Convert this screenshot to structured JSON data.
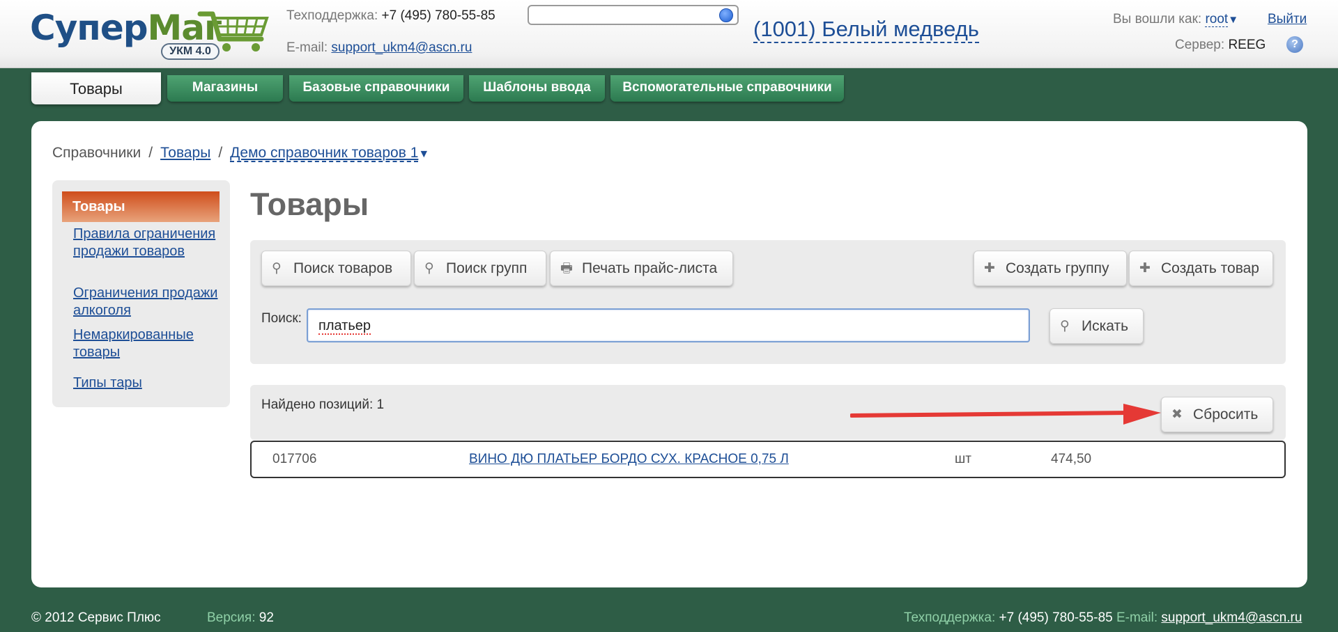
{
  "header": {
    "logo_part1": "Супер",
    "logo_part2": "Маг",
    "logo_badge": "УКМ 4.0",
    "support_phone_label": "Техподдержка:",
    "support_phone": "+7 (495) 780-55-85",
    "support_email_label": "E-mail:",
    "support_email": "support_ukm4@ascn.ru",
    "store": "(1001) Белый медведь",
    "logged_in_label": "Вы вошли как:",
    "user": "root",
    "logout": "Выйти",
    "server_label": "Сервер:",
    "server": "REEG",
    "help": "?"
  },
  "tabs": [
    {
      "label": "Товары",
      "active": true
    },
    {
      "label": "Магазины"
    },
    {
      "label": "Базовые справочники"
    },
    {
      "label": "Шаблоны ввода"
    },
    {
      "label": "Вспомогательные справочники"
    }
  ],
  "breadcrumbs": {
    "root": "Справочники",
    "sep": "/",
    "items": "Товары",
    "catalog": "Демо справочник товаров 1"
  },
  "sidenav": {
    "active": "Товары",
    "items": [
      "Правила ограничения продажи товаров",
      "Ограничения продажи алкоголя",
      "Немаркированные товары",
      "Типы тары"
    ]
  },
  "page_title": "Товары",
  "toolbar": {
    "search_goods": "Поиск товаров",
    "search_groups": "Поиск групп",
    "print_prices": "Печать прайс-листа",
    "create_group": "Создать группу",
    "create_item": "Создать товар",
    "search_label": "Поиск:",
    "search_value": "платьер",
    "search_button": "Искать"
  },
  "results": {
    "found_label": "Найдено позиций: 1",
    "reset_button": "Сбросить",
    "rows": [
      {
        "code": "017706",
        "name": "ВИНО ДЮ ПЛАТЬЕР БОРДО СУХ. КРАСНОЕ 0,75 Л",
        "unit": "шт",
        "price": "474,50"
      }
    ]
  },
  "footer": {
    "copyright": "© 2012 Сервис Плюс",
    "version_label": "Версия:",
    "version": "92",
    "support_label": "Техподдержка:",
    "support_phone": "+7 (495) 780-55-85",
    "email_label": "E-mail:",
    "email": "support_ukm4@ascn.ru"
  },
  "colors": {
    "background": "#2e5d46",
    "accent_blue": "#1d4e96",
    "active_nav": "#cf4d1b",
    "tab_green": "#3f915f",
    "arrow_red": "#e53935"
  }
}
